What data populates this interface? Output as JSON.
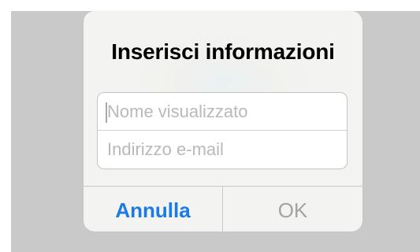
{
  "alert": {
    "title": "Inserisci informazioni",
    "fields": {
      "display_name": {
        "placeholder": "Nome visualizzato",
        "value": ""
      },
      "email": {
        "placeholder": "Indirizzo e-mail",
        "value": ""
      }
    },
    "buttons": {
      "cancel_label": "Annulla",
      "ok_label": "OK"
    }
  },
  "colors": {
    "accent": "#1a7ae6",
    "disabled": "#a3a3a3",
    "placeholder": "#b9b9bb",
    "backdrop": "#c9c9c9"
  }
}
